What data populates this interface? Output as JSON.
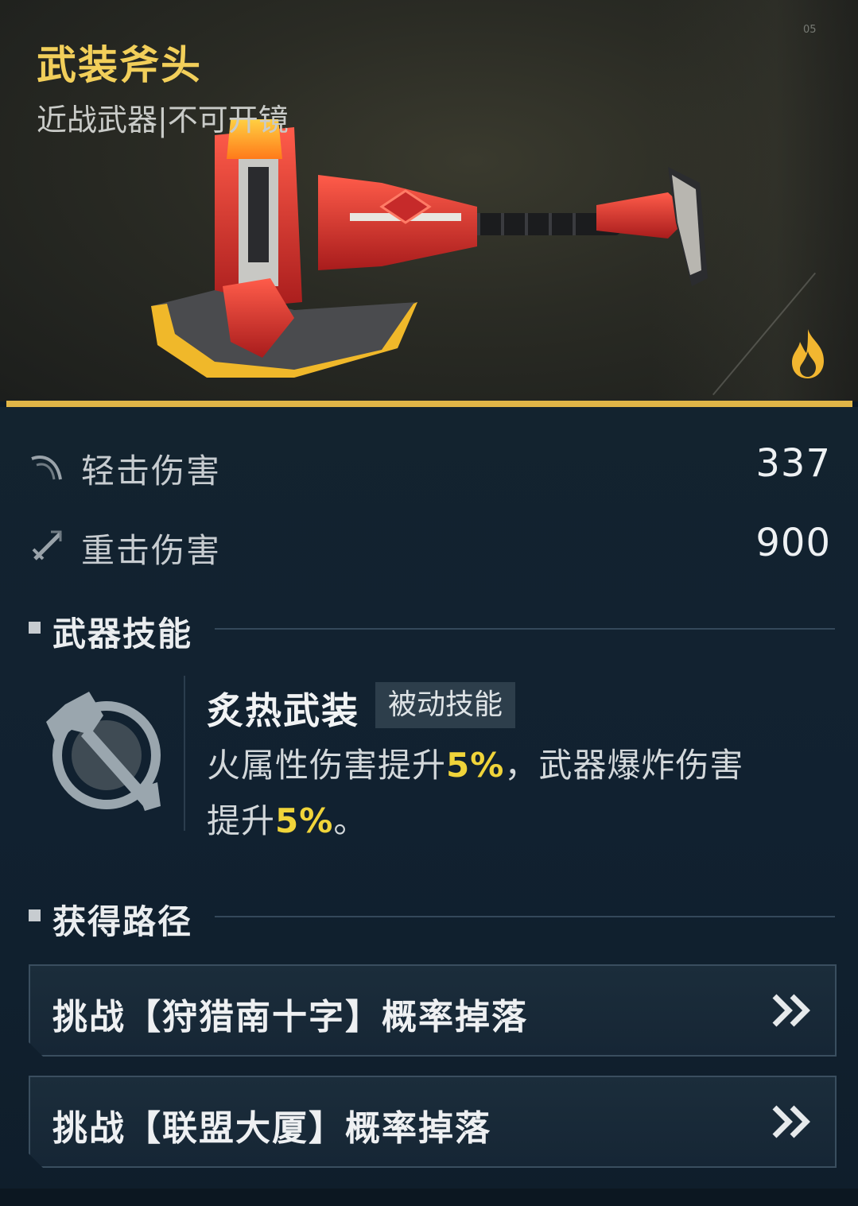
{
  "weapon": {
    "name": "武装斧头",
    "subtitle": "近战武器|不可开镜",
    "corner_tag": "05"
  },
  "stats": [
    {
      "label": "轻击伤害",
      "value": "337",
      "icon": "light-attack-icon"
    },
    {
      "label": "重击伤害",
      "value": "900",
      "icon": "heavy-attack-icon"
    }
  ],
  "skill_section": {
    "title": "武器技能",
    "skill": {
      "name": "炙热武装",
      "tag": "被动技能",
      "desc_part1": "火属性伤害提升",
      "desc_hl1": "5%",
      "desc_part2": "，武器爆炸伤害提升",
      "desc_hl2": "5%",
      "desc_part3": "。",
      "icon": "axe-skill-icon"
    }
  },
  "route_section": {
    "title": "获得路径",
    "routes": [
      {
        "label": "挑战【狩猎南十字】概率掉落"
      },
      {
        "label": "挑战【联盟大厦】概率掉落"
      }
    ]
  },
  "colors": {
    "gold": "#e0b547",
    "title_gold": "#f2cf5a",
    "highlight": "#f0d43a",
    "panel": "#112130"
  }
}
